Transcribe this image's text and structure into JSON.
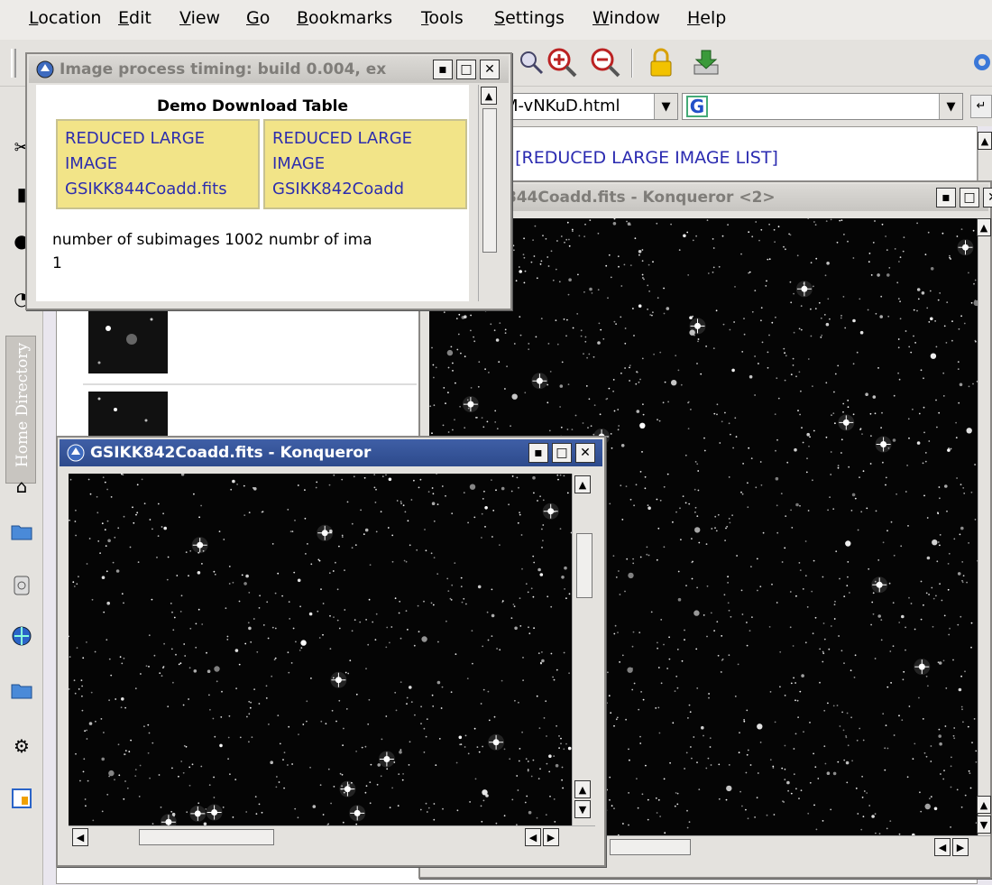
{
  "menu": [
    "Location",
    "Edit",
    "View",
    "Go",
    "Bookmarks",
    "Tools",
    "Settings",
    "Window",
    "Help"
  ],
  "location_bar": {
    "url_fragment": "M-vNKuD.html",
    "search_logo": "G"
  },
  "page": {
    "link_text": "o] [REDUCED LARGE IMAGE LIST]",
    "sidebar_label": "Home Directory"
  },
  "demo_window": {
    "title": "Image process timing: build 0.004, ex",
    "heading": "Demo Download Table",
    "cells": [
      {
        "line1": "REDUCED LARGE",
        "line2": "IMAGE",
        "line3": "GSIKK844Coadd.fits"
      },
      {
        "line1": "REDUCED LARGE",
        "line2": "IMAGE",
        "line3": "GSIKK842Coadd"
      }
    ],
    "subimages_text": "number of subimages 1002 numbr of ima",
    "tail": "1"
  },
  "window_844": {
    "title": "GSIKK844Coadd.fits - Konqueror <2>"
  },
  "window_842": {
    "title": "GSIKK842Coadd.fits - Konqueror"
  },
  "window_buttons": {
    "minimize": "▪",
    "maximize": "□",
    "close": "✕"
  },
  "colors": {
    "link": "#2a2ab0",
    "table_cell": "#f2e488",
    "active_title": "#2d4a8c",
    "inactive_title": "#c7c5c1",
    "sky": "#050505"
  }
}
